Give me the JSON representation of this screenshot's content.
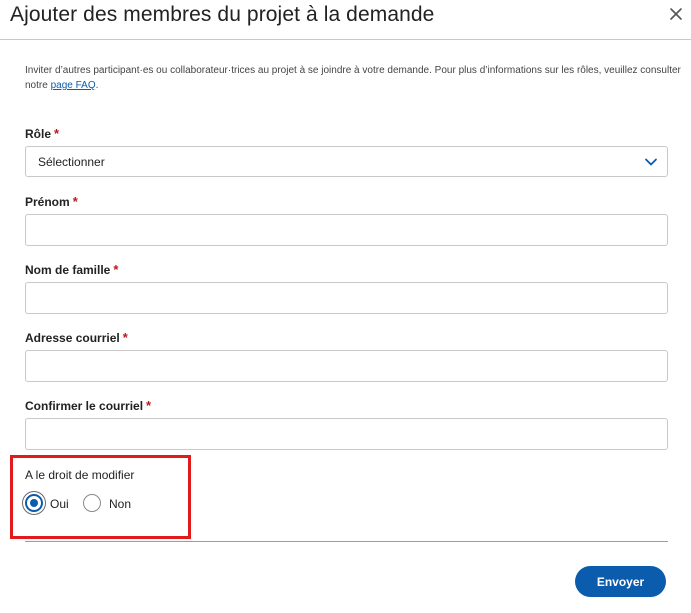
{
  "dialog": {
    "title": "Ajouter des membres du projet à la demande",
    "intro_text": "Inviter d’autres participant·es ou collaborateur·trices au projet à se joindre à votre demande. Pour plus d’informations sur les rôles, veuillez consulter notre ",
    "intro_link": "page FAQ",
    "intro_end": "."
  },
  "form": {
    "required_mark": "*",
    "role": {
      "label": "Rôle",
      "selected": "Sélectionner"
    },
    "first_name": {
      "label": "Prénom",
      "value": ""
    },
    "last_name": {
      "label": "Nom de famille",
      "value": ""
    },
    "email": {
      "label": "Adresse courriel",
      "value": ""
    },
    "confirm_email": {
      "label": "Confirmer le courriel",
      "value": ""
    },
    "edit_rights": {
      "label": "A le droit de modifier",
      "options": [
        {
          "label": "Oui",
          "checked": true
        },
        {
          "label": "Non",
          "checked": false
        }
      ]
    }
  },
  "actions": {
    "submit_label": "Envoyer"
  },
  "colors": {
    "accent": "#0b5cad",
    "required": "#c0161b",
    "highlight": "#e11b1b",
    "border": "#c9c9c9"
  },
  "icons": {
    "close": "close-icon",
    "dropdown": "chevron-down-icon"
  }
}
